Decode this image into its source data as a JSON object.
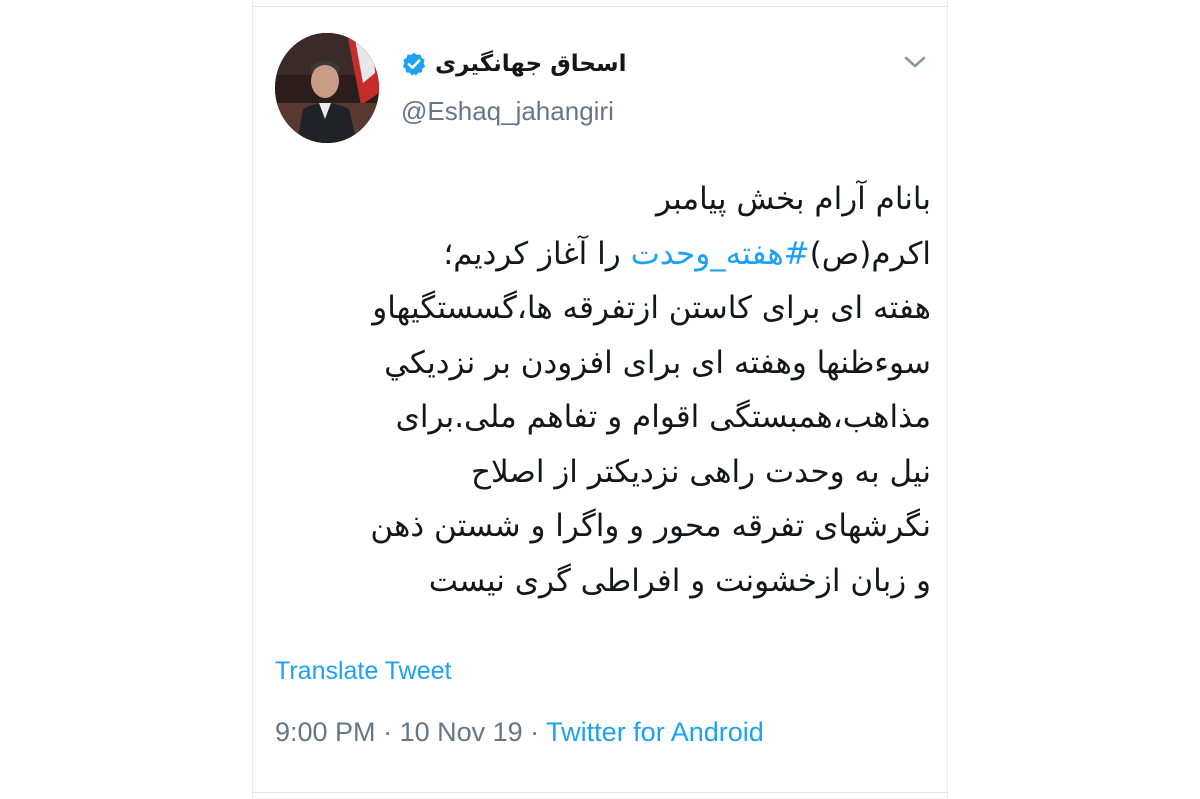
{
  "tweet": {
    "author": {
      "display_name": "اسحاق جهانگیری",
      "handle": "@Eshaq_jahangiri",
      "verified": true
    },
    "text_lines": [
      [
        "بانام آرام بخش پیامبر"
      ],
      [
        "اکرم(ص)",
        "#هفته_وحدت",
        " را آغاز کردیم؛"
      ],
      [
        "هفته ای برای کاستن ازتفرقه ها،گسستگیهاو"
      ],
      [
        "سوءظنها وهفته ای برای افزودن بر نزدیکي"
      ],
      [
        "مذاهب،همبستگی اقوام و تفاهم ملی.برای"
      ],
      [
        "نیل به وحدت راهی نزدیکتر از اصلاح"
      ],
      [
        "نگرشهای تفرقه محور و واگرا و شستن ذهن"
      ],
      [
        "و زبان ازخشونت و افراطی گری نیست"
      ]
    ],
    "hashtag": "#هفته_وحدت",
    "translate_label": "Translate Tweet",
    "time": "9:00 PM",
    "separator": " · ",
    "date": "10 Nov 19",
    "source": "Twitter for Android",
    "menu_icon": "chevron-down-icon",
    "verified_icon": "verified-badge-icon"
  },
  "colors": {
    "link": "#1da1f2",
    "text": "#14171a",
    "secondary": "#657786",
    "border": "#e6ecf0"
  }
}
